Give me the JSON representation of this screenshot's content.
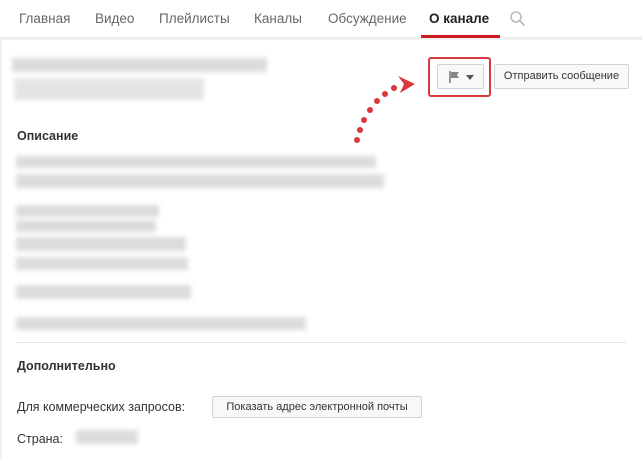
{
  "tabs": [
    {
      "label": "Главная"
    },
    {
      "label": "Видео"
    },
    {
      "label": "Плейлисты"
    },
    {
      "label": "Каналы"
    },
    {
      "label": "Обсуждение"
    },
    {
      "label": "О канале",
      "active": true
    }
  ],
  "icons": {
    "search": "search-icon",
    "flag": "flag-icon",
    "dropdown": "caret-down-icon"
  },
  "actions": {
    "send_message": "Отправить сообщение"
  },
  "sections": {
    "description_title": "Описание",
    "additional_title": "Дополнительно",
    "business_label": "Для коммерческих запросов:",
    "show_email": "Показать адрес электронной почты",
    "country_label": "Страна:"
  },
  "colors": {
    "accent": "#cc181e",
    "annotation": "#d9383c"
  }
}
